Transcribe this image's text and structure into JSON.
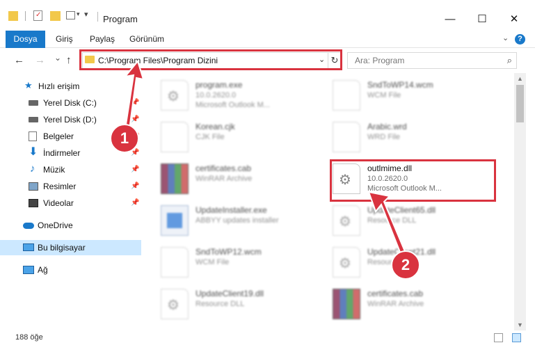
{
  "window": {
    "title": "Program",
    "minimize_glyph": "—",
    "maximize_glyph": "☐",
    "close_glyph": "✕"
  },
  "ribbon": {
    "tabs": [
      "Dosya",
      "Giriş",
      "Paylaş",
      "Görünüm"
    ],
    "collapse_glyph": "⌄",
    "help_glyph": "?"
  },
  "nav": {
    "back_glyph": "←",
    "forward_glyph": "→",
    "recent_glyph": "⌄",
    "up_glyph": "↑"
  },
  "address": {
    "path": "C:\\Program Files\\Program Dizini",
    "dropdown_glyph": "⌄",
    "refresh_glyph": "↻"
  },
  "search": {
    "placeholder": "Ara: Program",
    "icon_glyph": "⌕"
  },
  "sidebar": {
    "items": [
      {
        "label": "Hızlı erişim",
        "icon": "star-icon"
      },
      {
        "label": "Yerel Disk (C:)",
        "icon": "drive-icon"
      },
      {
        "label": "Yerel Disk (D:)",
        "icon": "drive-icon"
      },
      {
        "label": "Belgeler",
        "icon": "documents-icon"
      },
      {
        "label": "İndirmeler",
        "icon": "downloads-icon"
      },
      {
        "label": "Müzik",
        "icon": "music-icon"
      },
      {
        "label": "Resimler",
        "icon": "pictures-icon"
      },
      {
        "label": "Videolar",
        "icon": "videos-icon"
      },
      {
        "label": "OneDrive",
        "icon": "cloud-icon"
      },
      {
        "label": "Bu bilgisayar",
        "icon": "computer-icon"
      },
      {
        "label": "Ağ",
        "icon": "network-icon"
      }
    ],
    "pin_glyph": "📌"
  },
  "files": [
    {
      "name": "program.exe",
      "line1": "10.0.2620.0",
      "line2": "Microsoft Outlook M...",
      "icon": "exe-icon"
    },
    {
      "name": "SndToWP14.wcm",
      "line1": "WCM File",
      "line2": "",
      "icon": "file-icon"
    },
    {
      "name": "Korean.cjk",
      "line1": "CJK File",
      "line2": "",
      "icon": "file-icon"
    },
    {
      "name": "Arabic.wrd",
      "line1": "WRD File",
      "line2": "",
      "icon": "file-icon"
    },
    {
      "name": "certificates.cab",
      "line1": "WinRAR Archive",
      "line2": "",
      "icon": "archive-icon"
    },
    {
      "name": "outlmime.dll",
      "line1": "10.0.2620.0",
      "line2": "Microsoft Outlook M...",
      "icon": "dll-icon"
    },
    {
      "name": "UpdateInstaller.exe",
      "line1": "ABBYY updates installer",
      "line2": "",
      "icon": "setup-icon"
    },
    {
      "name": "UpdateClient65.dll",
      "line1": "Resource DLL",
      "line2": "",
      "icon": "dll-icon"
    },
    {
      "name": "SndToWP12.wcm",
      "line1": "WCM File",
      "line2": "",
      "icon": "file-icon"
    },
    {
      "name": "UpdateClient21.dll",
      "line1": "Resource DLL",
      "line2": "",
      "icon": "dll-icon"
    },
    {
      "name": "UpdateClient19.dll",
      "line1": "Resource DLL",
      "line2": "",
      "icon": "dll-icon"
    },
    {
      "name": "certificates.cab",
      "line1": "WinRAR Archive",
      "line2": "",
      "icon": "archive-icon"
    }
  ],
  "status": {
    "count": "188 öğe"
  },
  "annotations": {
    "step1": "1",
    "step2": "2",
    "color": "#d9333f"
  }
}
